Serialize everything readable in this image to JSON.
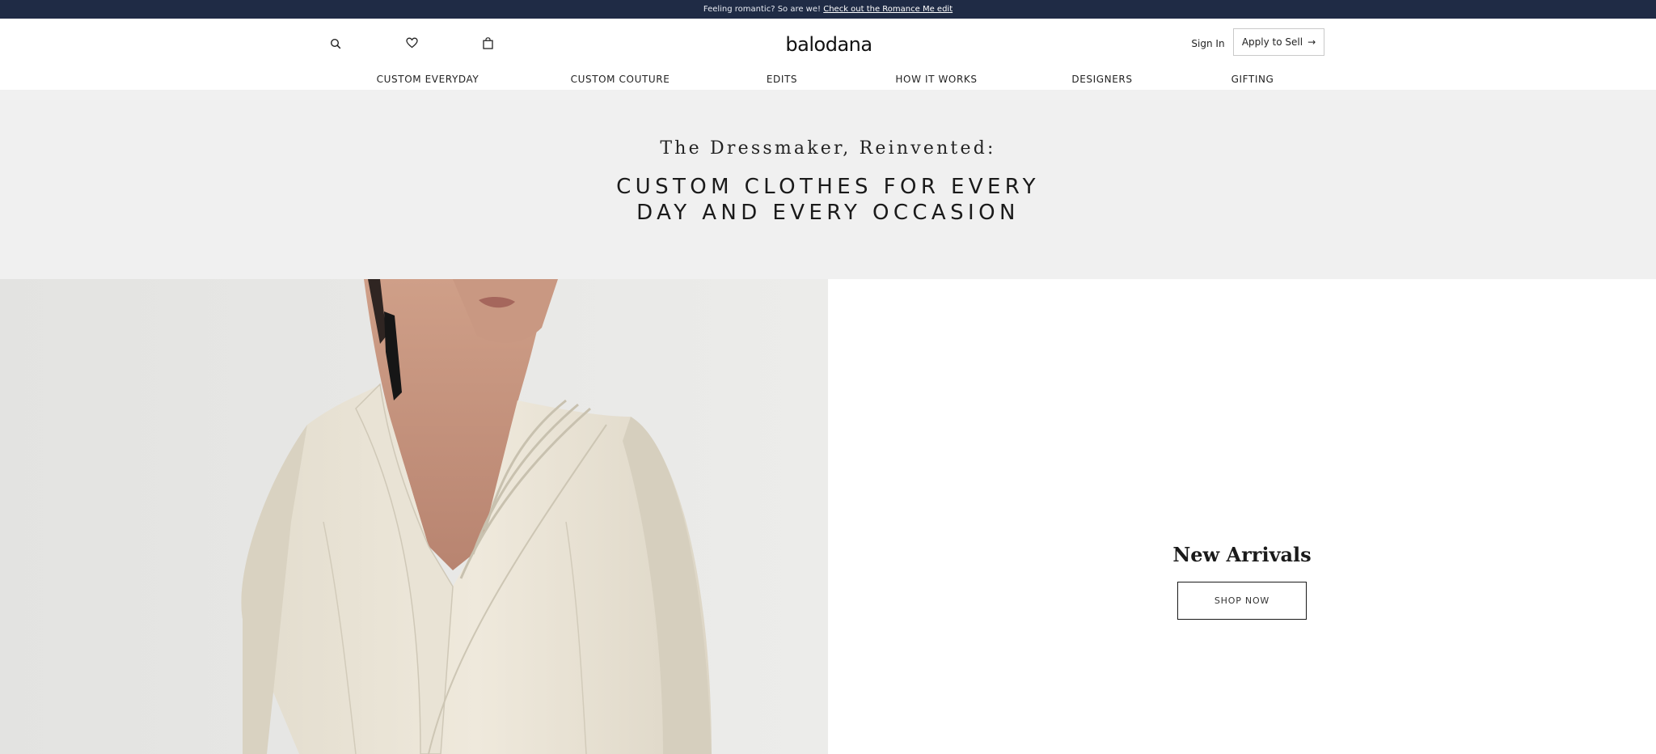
{
  "announcement": {
    "text": "Feeling romantic? So are we! ",
    "link": "Check out the Romance Me edit"
  },
  "header": {
    "logo": "balodana",
    "icons": {
      "search": "search-icon",
      "wishlist": "heart-icon",
      "bag": "shopping-bag-icon"
    },
    "sign_in": "Sign In",
    "apply": "Apply to Sell",
    "apply_arrow": "→"
  },
  "nav": {
    "items": [
      {
        "label": "CUSTOM EVERYDAY"
      },
      {
        "label": "CUSTOM COUTURE"
      },
      {
        "label": "EDITS"
      },
      {
        "label": "HOW IT WORKS"
      },
      {
        "label": "DESIGNERS"
      },
      {
        "label": "GIFTING"
      }
    ]
  },
  "hero": {
    "tagline": "The Dressmaker, Reinvented:",
    "headline": "CUSTOM CLOTHES FOR EVERY DAY AND EVERY OCCASION"
  },
  "feature": {
    "title": "New Arrivals",
    "button": "SHOP NOW"
  },
  "colors": {
    "announcement_bg": "#1f2b45",
    "hero_bg": "#f0f0f0",
    "garment": "#ece7da"
  }
}
